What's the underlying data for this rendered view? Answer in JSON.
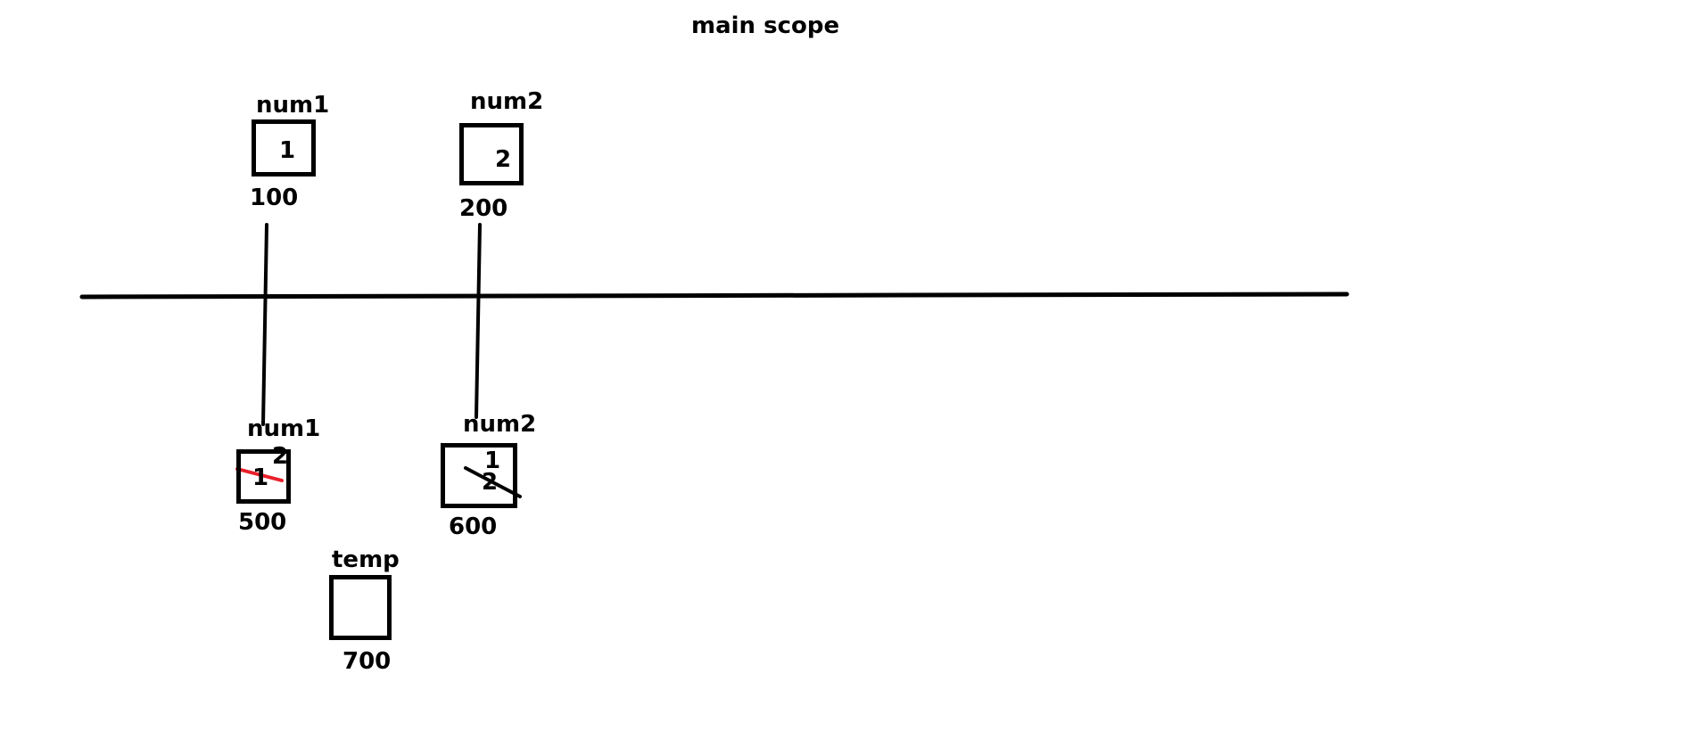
{
  "title": "main scope",
  "colors": {
    "ink": "#000000",
    "strike_red": "#e8202a",
    "background": "#ffffff"
  },
  "main_scope_vars": [
    {
      "name": "num1",
      "value": "1",
      "address": "100"
    },
    {
      "name": "num2",
      "value": "2",
      "address": "200"
    }
  ],
  "function_scope_vars": [
    {
      "name": "num1",
      "old_value": "1",
      "new_value": "2",
      "address": "500",
      "old_value_struck": true,
      "strike_color": "red"
    },
    {
      "name": "num2",
      "old_value": "2",
      "new_value": "1",
      "address": "600",
      "old_value_struck": true,
      "strike_color": "black"
    },
    {
      "name": "temp",
      "value": "",
      "address": "700"
    }
  ]
}
